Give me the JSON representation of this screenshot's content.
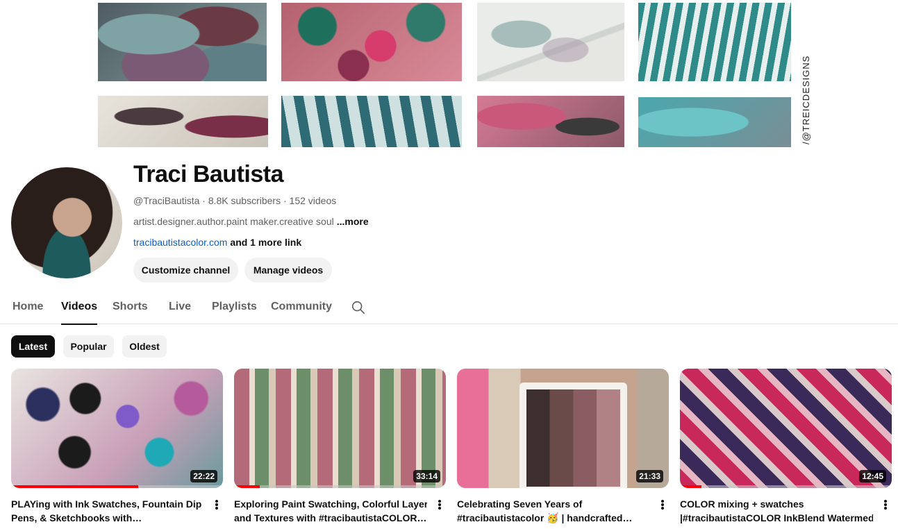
{
  "banner": {
    "vertical_text": "/@TREICDESIGNS"
  },
  "channel": {
    "name": "Traci Bautista",
    "meta": "@TraciBautista · 8.8K subscribers · 152 videos",
    "description": "artist.designer.author.paint maker.creative soul",
    "more_label": "...more",
    "link_url": "tracibautistacolor.com",
    "link_extra": "and 1 more link",
    "customize_label": "Customize channel",
    "manage_label": "Manage videos"
  },
  "tabs": {
    "home": "Home",
    "videos": "Videos",
    "shorts": "Shorts",
    "live": "Live",
    "playlists": "Playlists",
    "community": "Community",
    "active": "Videos"
  },
  "chips": {
    "latest": "Latest",
    "popular": "Popular",
    "oldest": "Oldest",
    "selected": "Latest"
  },
  "videos": [
    {
      "duration": "22:22",
      "title_l1": "PLAYing with Ink Swatches, Fountain Dip",
      "title_l2": "Pens, & Sketchbooks with…",
      "watched_fraction": 0.6
    },
    {
      "duration": "33:14",
      "title_l1": "Exploring Paint Swatching, Colorful Layers",
      "title_l2": "and Textures with #tracibautistaCOLOR…",
      "watched_fraction": 0.12
    },
    {
      "duration": "21:33",
      "title_l1": "Celebrating Seven Years of",
      "title_l2": "#tracibautistacolor 🥳 | handcrafted…",
      "watched_fraction": 0
    },
    {
      "duration": "12:45",
      "title_l1": "COLOR mixing + swatches",
      "title_l2": "|#tracibautistaCOLOR InkBlend Watermedi…",
      "watched_fraction": 0.1
    }
  ],
  "colors": {
    "accent_link": "#065fd4",
    "progress": "#ff0000",
    "chip_selected": "#0f0f0f"
  }
}
